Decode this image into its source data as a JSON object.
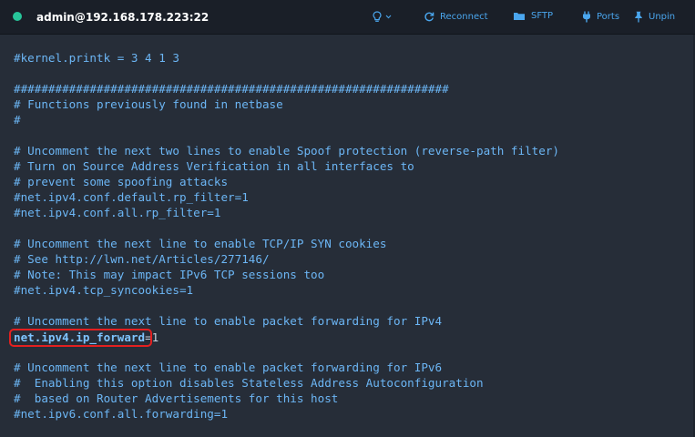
{
  "titlebar": {
    "host": "admin@192.168.178.223:22",
    "status_color": "#27c59a",
    "actions": {
      "theme_icon": "lightbulb-icon",
      "reconnect_label": "Reconnect",
      "sftp_label": "SFTP",
      "ports_label": "Ports",
      "unpin_label": "Unpin"
    }
  },
  "terminal": {
    "lines": [
      "#kernel.printk = 3 4 1 3",
      "",
      "###############################################################",
      "# Functions previously found in netbase",
      "#",
      "",
      "# Uncomment the next two lines to enable Spoof protection (reverse-path filter)",
      "# Turn on Source Address Verification in all interfaces to",
      "# prevent some spoofing attacks",
      "#net.ipv4.conf.default.rp_filter=1",
      "#net.ipv4.conf.all.rp_filter=1",
      "",
      "# Uncomment the next line to enable TCP/IP SYN cookies",
      "# See http://lwn.net/Articles/277146/",
      "# Note: This may impact IPv6 TCP sessions too",
      "#net.ipv4.tcp_syncookies=1",
      "",
      "# Uncomment the next line to enable packet forwarding for IPv4",
      "",
      "",
      "# Uncomment the next line to enable packet forwarding for IPv6",
      "#  Enabling this option disables Stateless Address Autoconfiguration",
      "#  based on Router Advertisements for this host",
      "#net.ipv6.conf.all.forwarding=1"
    ],
    "highlight": {
      "key": "net.ipv4.ip_forward",
      "eq": "=",
      "value": "1"
    },
    "highlight_color": "#e32020"
  }
}
